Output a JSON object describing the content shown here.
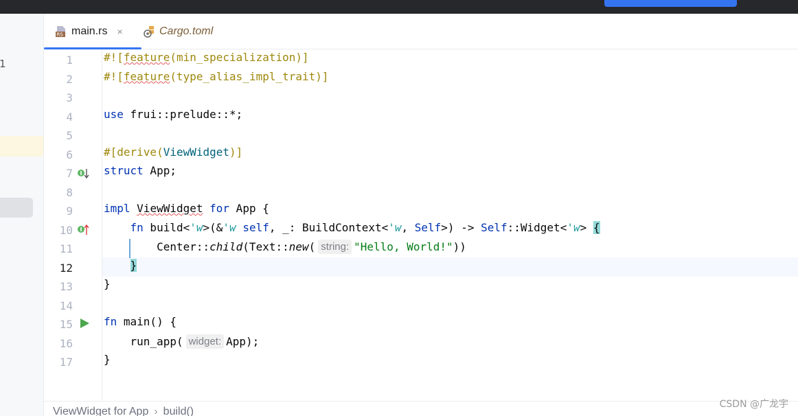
{
  "tabs": [
    {
      "label": "main.rs",
      "icon": "rust-file-icon",
      "active": true,
      "close": "×"
    },
    {
      "label": "Cargo.toml",
      "icon": "cargo-settings-icon",
      "active": false
    }
  ],
  "left_panel": {
    "visible_number": "1"
  },
  "editor": {
    "line_numbers": [
      "1",
      "2",
      "3",
      "4",
      "5",
      "6",
      "7",
      "8",
      "9",
      "10",
      "11",
      "12",
      "13",
      "14",
      "15",
      "16",
      "17"
    ],
    "current_line": "12",
    "inlay_hints": {
      "string": "string:",
      "widget": "widget:"
    }
  },
  "tokens": {
    "l1a": "#![",
    "l1b": "feature",
    "l1c": "(min_specialization)]",
    "l2a": "#![",
    "l2b": "feature",
    "l2c": "(type_alias_impl_trait)]",
    "l4a": "use",
    "l4b": " frui::prelude::*;",
    "l6a": "#[derive(",
    "l6b": "ViewWidget",
    "l6c": ")]",
    "l7a": "struct",
    "l7b": " App;",
    "l9a": "impl",
    "l9b": "ViewWidget",
    "l9c": "for",
    "l9d": " App {",
    "l10a": "fn",
    "l10b": " build<",
    "l10c": "'w",
    "l10d": ">(&",
    "l10e": "'w",
    "l10f": "self",
    "l10g": ", _: BuildContext<",
    "l10h": "'w",
    "l10i": ", ",
    "l10j": "Self",
    "l10k": ">) -> ",
    "l10l": "Self",
    "l10m": "::Widget<",
    "l10n": "'w",
    "l10o": "> ",
    "l10p": "{",
    "l11a": "Center::",
    "l11b": "child",
    "l11c": "(Text::",
    "l11d": "new",
    "l11e": "(",
    "l11f": "\"Hello, World!\"",
    "l11g": "))",
    "l12a": "}",
    "l13a": "}",
    "l15a": "fn",
    "l15b": " main() {",
    "l16a": "run_app(",
    "l16b": "App);",
    "l17a": "}"
  },
  "breadcrumb": [
    "ViewWidget for App",
    "build()"
  ],
  "breadcrumb_sep": "›",
  "watermark": "CSDN @广龙宇",
  "colors": {
    "accent": "#3574f0",
    "keyword": "#0033b3",
    "attribute": "#9e880d",
    "string": "#067d17",
    "type": "#00627a"
  }
}
